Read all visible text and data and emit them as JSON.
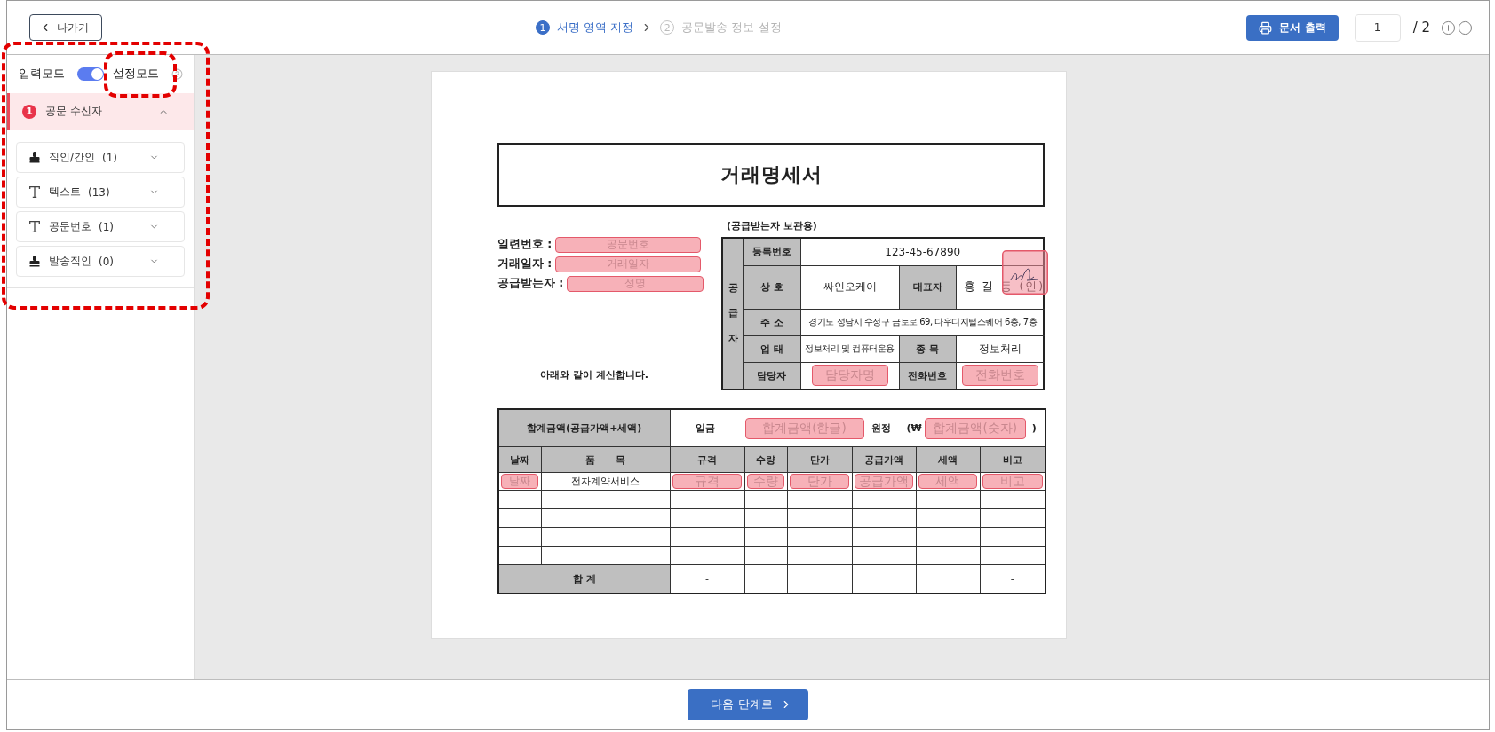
{
  "top_bar": {
    "back_button": "나가기",
    "steps": [
      {
        "number": "1",
        "label": "서명 영역 지정",
        "selected": true
      },
      {
        "number": "2",
        "label": "공문발송 정보 설정",
        "selected": false
      }
    ],
    "print_button": "문서 출력",
    "page_input": "1",
    "page_total": "/ 2"
  },
  "sidebar": {
    "mode_toggle": {
      "left_label": "입력모드",
      "right_label": "설정모드",
      "on": true
    },
    "section": {
      "number": "1",
      "title": "공문 수신자",
      "expanded": true
    },
    "items": [
      {
        "kind": "stamp",
        "label": "직인/간인",
        "count": "(1)",
        "expanded": false
      },
      {
        "kind": "text",
        "label": "텍스트",
        "count": "(13)",
        "expanded": false
      },
      {
        "kind": "text",
        "label": "공문번호",
        "count": "(1)",
        "expanded": false
      },
      {
        "kind": "stamp",
        "label": "발송직인",
        "count": "(0)",
        "expanded": false
      }
    ]
  },
  "document": {
    "title": "거래명세서",
    "copy_note": "(공급받는자 보관용)",
    "left_fields": [
      {
        "label": "일련번호 :",
        "field": "공문번호"
      },
      {
        "label": "거래일자 :",
        "field": "거래일자"
      },
      {
        "label": "공급받는자 :",
        "field": "성명"
      }
    ],
    "note": "아래와 같이 계산합니다.",
    "supplier": {
      "side_label": "공급자",
      "rows": [
        {
          "cells": [
            {
              "kind": "label",
              "text": "등록번호"
            },
            {
              "kind": "value",
              "text": "123-45-67890",
              "colspan": 3
            }
          ]
        },
        {
          "cells": [
            {
              "kind": "label",
              "text": "상 호"
            },
            {
              "kind": "value",
              "text": "싸인오케이"
            },
            {
              "kind": "label",
              "text": "대표자"
            },
            {
              "kind": "signature",
              "text": "홍 길 동 (인)"
            }
          ]
        },
        {
          "cells": [
            {
              "kind": "label",
              "text": "주 소"
            },
            {
              "kind": "small",
              "text": "경기도 성남시 수정구 금토로 69, 다우디지털스퀘어 6층, 7층",
              "colspan": 3
            }
          ]
        },
        {
          "cells": [
            {
              "kind": "label",
              "text": "업 태"
            },
            {
              "kind": "small",
              "text": "정보처리 및 컴퓨터운용"
            },
            {
              "kind": "label",
              "text": "종 목"
            },
            {
              "kind": "value",
              "text": "정보처리"
            }
          ]
        },
        {
          "cells": [
            {
              "kind": "label",
              "text": "담당자"
            },
            {
              "kind": "field",
              "text": "담당자명"
            },
            {
              "kind": "label",
              "text": "전화번호"
            },
            {
              "kind": "field",
              "text": "전화번호"
            }
          ]
        }
      ]
    },
    "totals": {
      "label": "합계금액(공급가액+세액)",
      "prefix": "일금",
      "korean_field": "합계금액(한글)",
      "suffix": "원정",
      "currency_open": "(₩",
      "number_field": "합계금액(숫자)",
      "close": ")"
    },
    "items": {
      "columns": [
        "날짜",
        "품      목",
        "규격",
        "수량",
        "단가",
        "공급가액",
        "세액",
        "비고"
      ],
      "rows": [
        {
          "cells": [
            {
              "kind": "field",
              "text": "날짜"
            },
            {
              "kind": "text",
              "text": "전자계약서비스"
            },
            {
              "kind": "field",
              "text": "규격"
            },
            {
              "kind": "field",
              "text": "수량"
            },
            {
              "kind": "field",
              "text": "단가"
            },
            {
              "kind": "field",
              "text": "공급가액"
            },
            {
              "kind": "field",
              "text": "세액"
            },
            {
              "kind": "field",
              "text": "비고"
            }
          ]
        }
      ],
      "sum_row": {
        "label": "합 계",
        "spec": "-",
        "remark": "-"
      }
    }
  },
  "next_button": "다음 단계로",
  "annotations": {
    "sidebar_box": true,
    "mode_label_box": true
  }
}
